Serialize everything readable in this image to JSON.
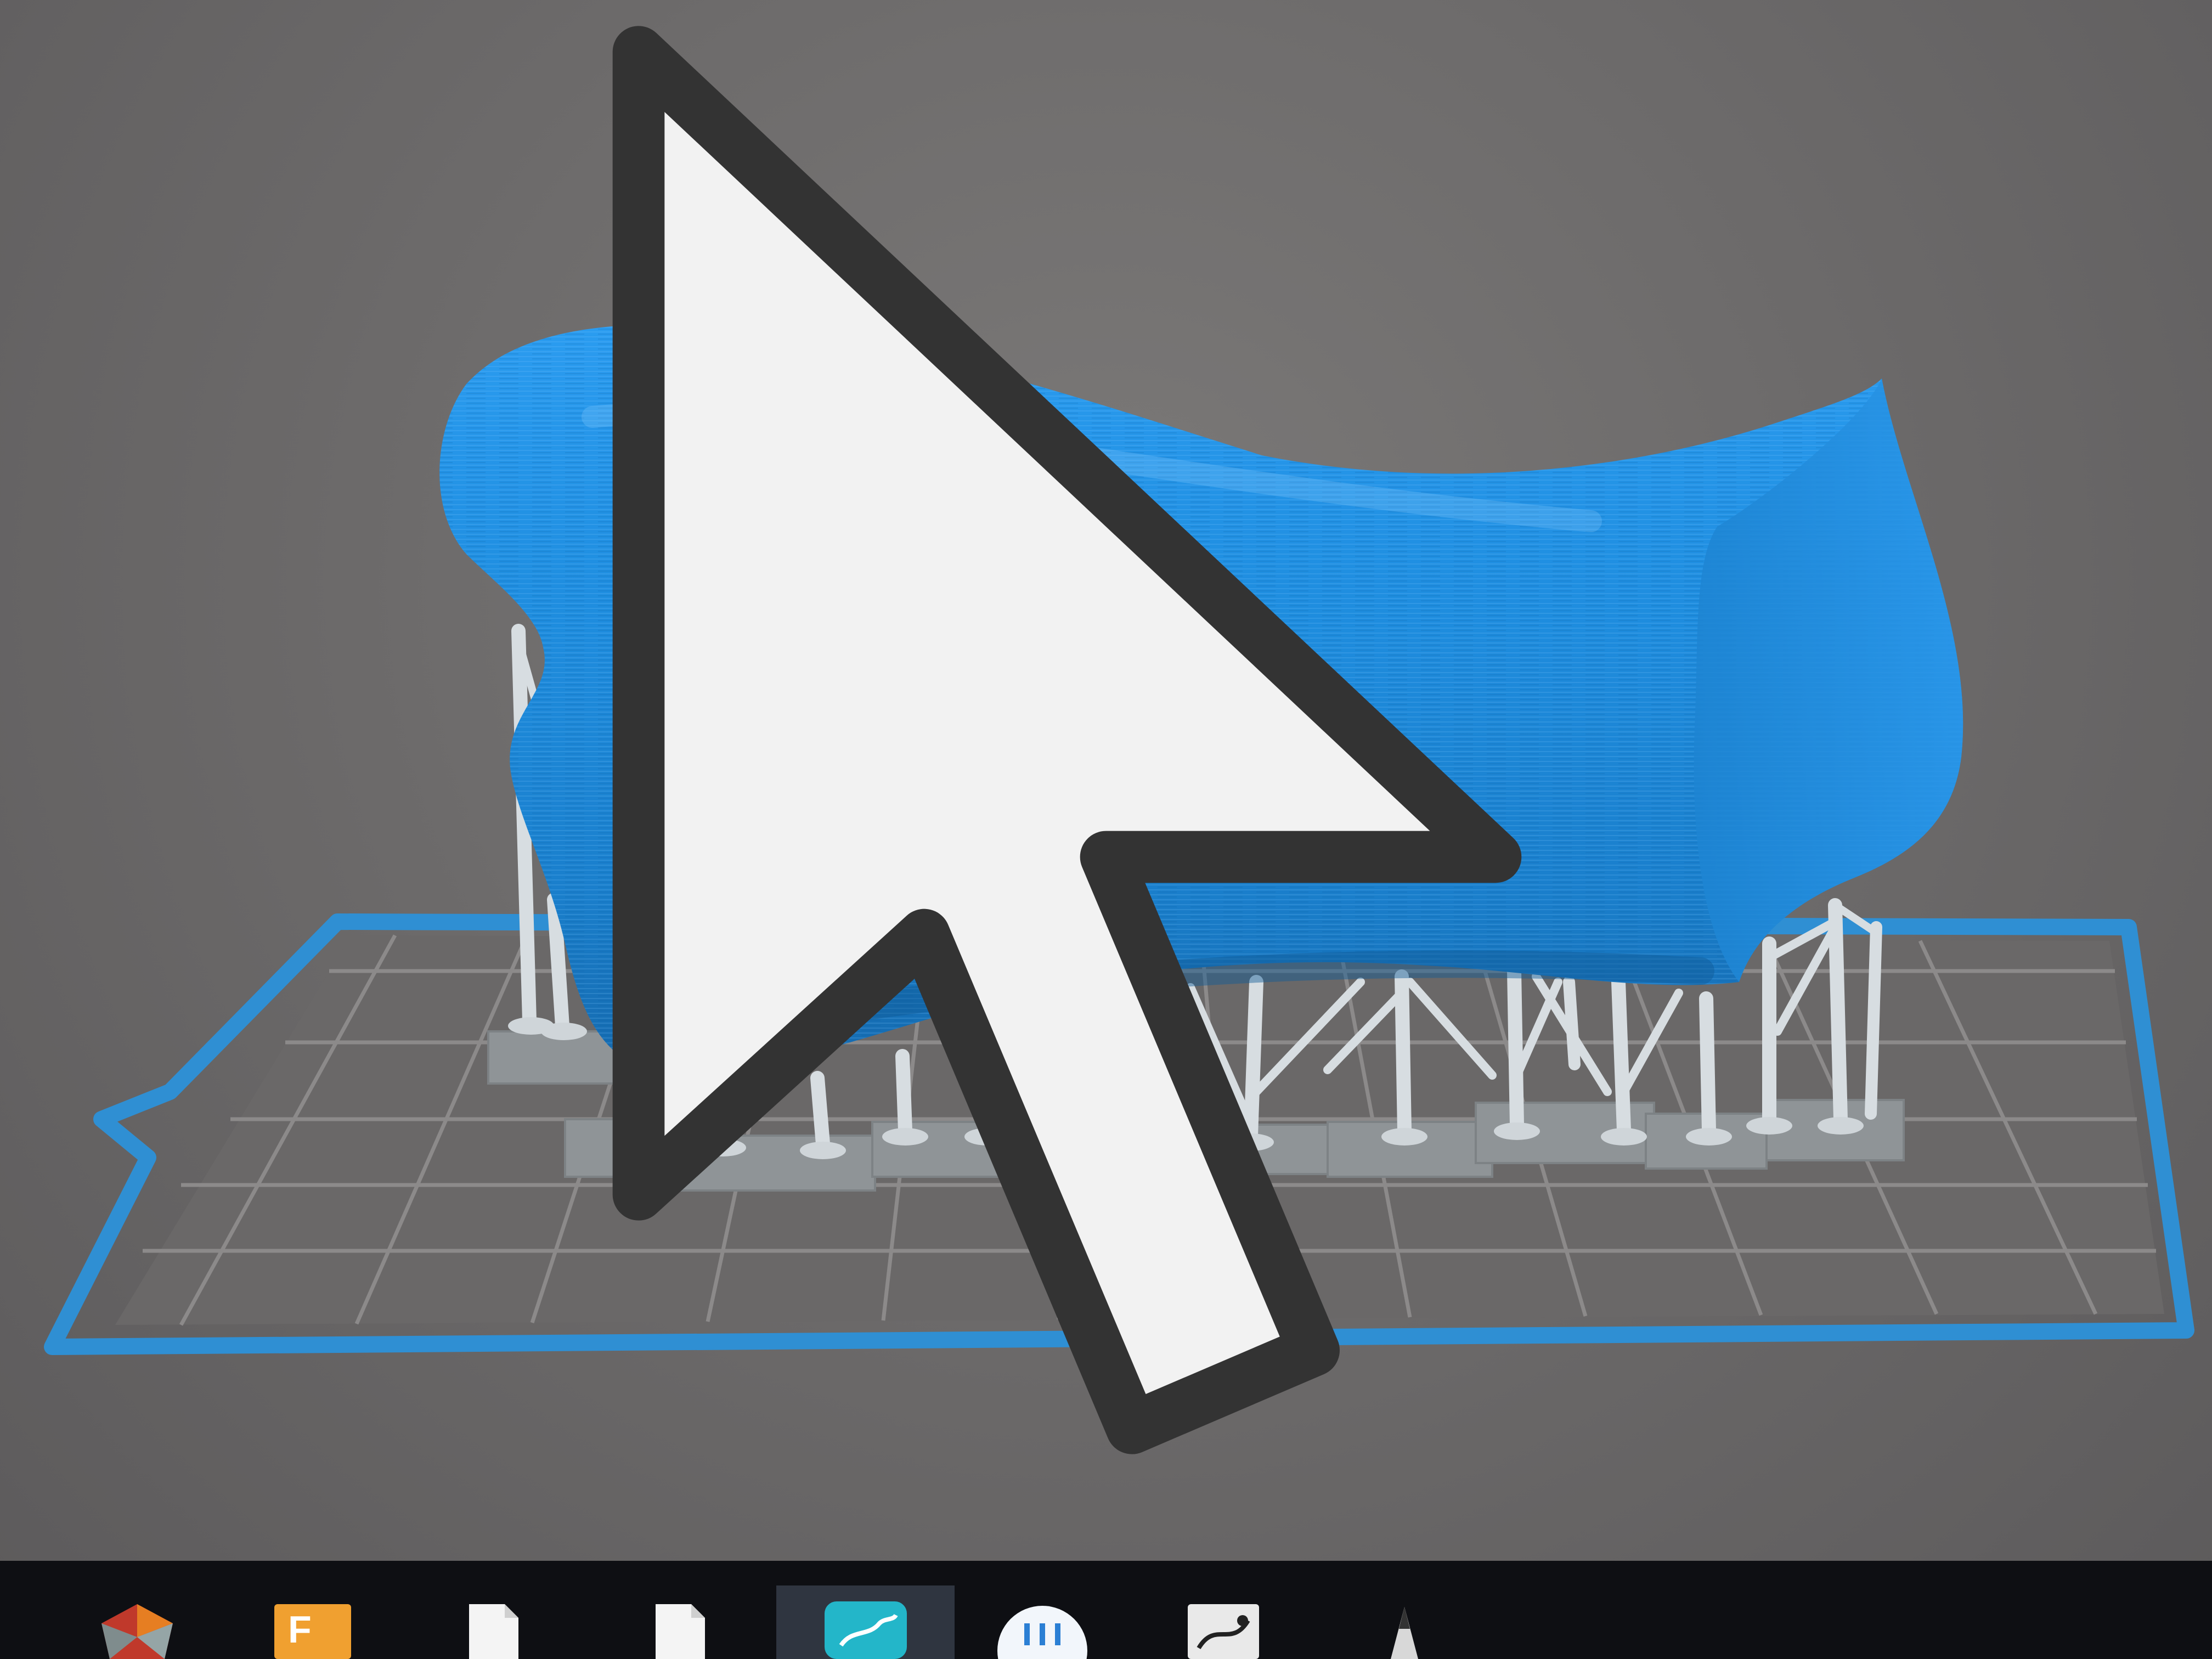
{
  "app": {
    "view": "3d-build-plate-viewport",
    "model_color": "#1a86d6",
    "support_color": "#d7dde1",
    "plate_frame_color": "#2f8fd3",
    "plate_grid_color": "#8c8a8a"
  },
  "viewport": {
    "model_label": "",
    "cursor_icon": "arrow-cursor-icon"
  },
  "taskbar": {
    "items": [
      {
        "name": "meshmixer-icon",
        "label": "",
        "active": false
      },
      {
        "name": "fusion-360-icon",
        "label": "",
        "active": false
      },
      {
        "name": "document-icon",
        "label": "",
        "active": false
      },
      {
        "name": "document-icon-2",
        "label": "",
        "active": false
      },
      {
        "name": "preform-icon",
        "label": "",
        "active": true
      },
      {
        "name": "app-circle-icon",
        "label": "",
        "active": false
      },
      {
        "name": "motion-app-icon",
        "label": "",
        "active": false
      },
      {
        "name": "pen-tool-icon",
        "label": "",
        "active": false
      }
    ]
  }
}
